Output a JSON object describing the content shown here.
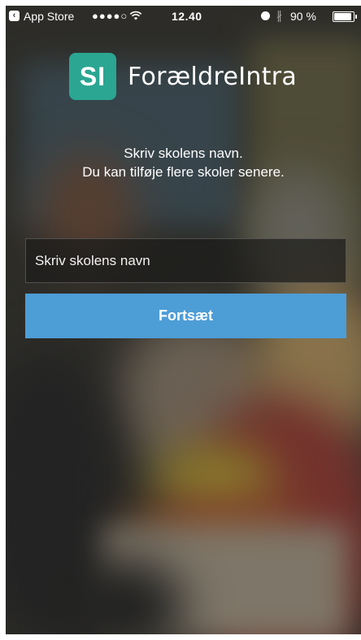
{
  "status_bar": {
    "back_app": "App Store",
    "signal": "●●●●○",
    "time": "12.40",
    "battery_text": "90 %",
    "battery_level": 0.9
  },
  "logo": {
    "badge": "SI",
    "name": "ForældreIntra",
    "color": "#2aa692"
  },
  "instructions": {
    "line1": "Skriv skolens navn.",
    "line2": "Du kan tilføje flere skoler senere."
  },
  "form": {
    "school_placeholder": "Skriv skolens navn",
    "continue_label": "Fortsæt",
    "button_color": "#4d9dd6"
  }
}
